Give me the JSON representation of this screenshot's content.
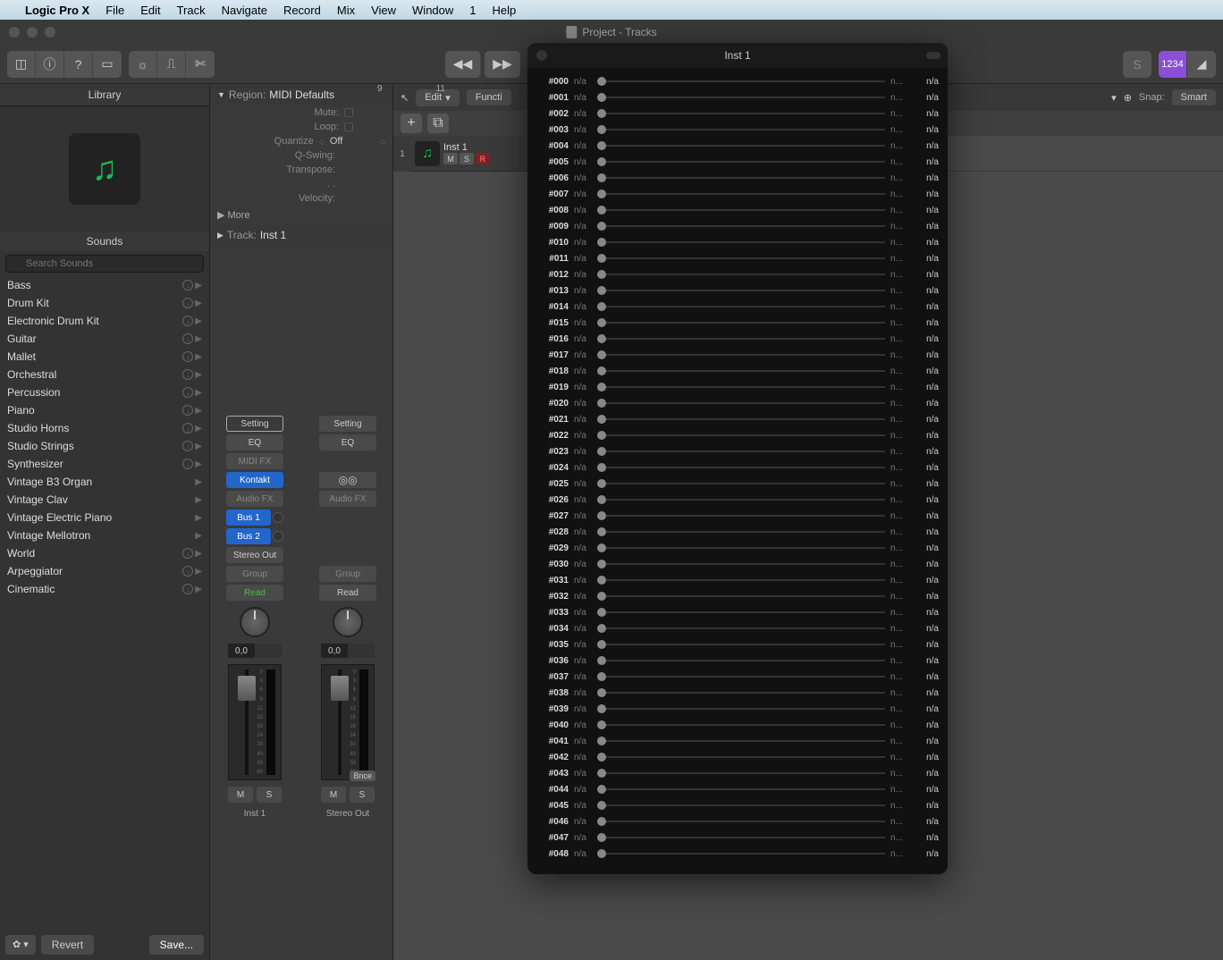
{
  "menubar": {
    "app": "Logic Pro X",
    "items": [
      "File",
      "Edit",
      "Track",
      "Navigate",
      "Record",
      "Mix",
      "View",
      "Window",
      "1",
      "Help"
    ]
  },
  "window": {
    "title": "Project - Tracks"
  },
  "toolbar": {
    "beat_display": "1234"
  },
  "library": {
    "header": "Library",
    "sounds_header": "Sounds",
    "search_placeholder": "Search Sounds",
    "items": [
      {
        "name": "Bass",
        "dl": true
      },
      {
        "name": "Drum Kit",
        "dl": true
      },
      {
        "name": "Electronic Drum Kit",
        "dl": true
      },
      {
        "name": "Guitar",
        "dl": true
      },
      {
        "name": "Mallet",
        "dl": true
      },
      {
        "name": "Orchestral",
        "dl": true
      },
      {
        "name": "Percussion",
        "dl": true
      },
      {
        "name": "Piano",
        "dl": true
      },
      {
        "name": "Studio Horns",
        "dl": true
      },
      {
        "name": "Studio Strings",
        "dl": true
      },
      {
        "name": "Synthesizer",
        "dl": true
      },
      {
        "name": "Vintage B3 Organ",
        "dl": false
      },
      {
        "name": "Vintage Clav",
        "dl": false
      },
      {
        "name": "Vintage Electric Piano",
        "dl": false
      },
      {
        "name": "Vintage Mellotron",
        "dl": false
      },
      {
        "name": "World",
        "dl": true
      },
      {
        "name": "Arpeggiator",
        "dl": true
      },
      {
        "name": "Cinematic",
        "dl": true
      }
    ],
    "revert": "Revert",
    "save": "Save..."
  },
  "inspector": {
    "region_label": "Region:",
    "region_value": "MIDI Defaults",
    "params": {
      "mute": "Mute:",
      "loop": "Loop:",
      "quantize": "Quantize",
      "quantize_val": "Off",
      "qswing": "Q-Swing:",
      "transpose": "Transpose:",
      "dots": ". .",
      "velocity": "Velocity:"
    },
    "more": "More",
    "track_label": "Track:",
    "track_value": "Inst 1",
    "strip1": {
      "setting": "Setting",
      "eq": "EQ",
      "midifx": "MIDI FX",
      "inst": "Kontakt",
      "audiofx": "Audio FX",
      "bus1": "Bus 1",
      "bus2": "Bus 2",
      "output": "Stereo Out",
      "group": "Group",
      "auto": "Read",
      "pan": "0,0",
      "m": "M",
      "s": "S",
      "name": "Inst 1"
    },
    "strip2": {
      "setting": "Setting",
      "eq": "EQ",
      "audiofx": "Audio FX",
      "group": "Group",
      "auto": "Read",
      "pan": "0,0",
      "bnce": "Bnce",
      "m": "M",
      "s": "S",
      "name": "Stereo Out"
    }
  },
  "tracks": {
    "edit": "Edit",
    "functions": "Functi",
    "snap_label": "Snap:",
    "snap_value": "Smart",
    "ruler": [
      "9",
      "11"
    ],
    "track1": {
      "num": "1",
      "name": "Inst 1",
      "m": "M",
      "s": "S",
      "r": "R"
    }
  },
  "float": {
    "title": "Inst 1",
    "na": "n/a",
    "nlabel": "n...",
    "count": 49
  }
}
